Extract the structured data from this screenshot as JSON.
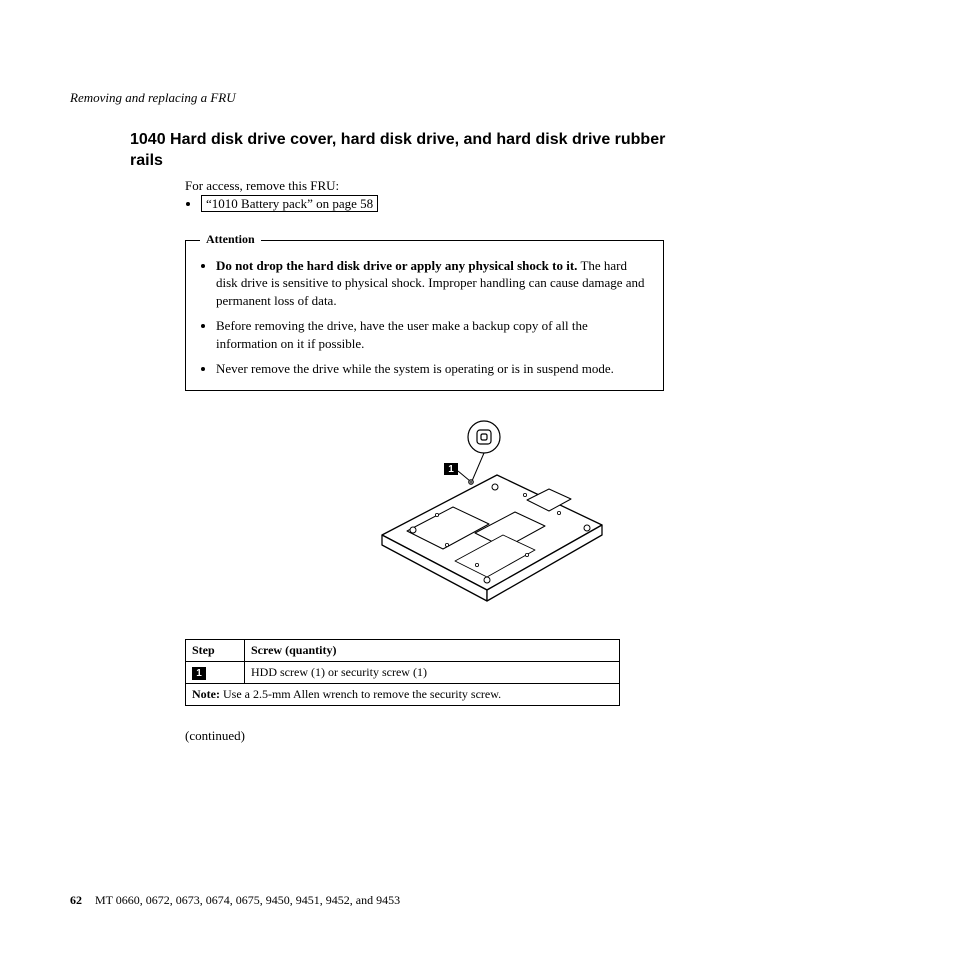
{
  "runningHead": "Removing and replacing a FRU",
  "section": {
    "title": "1040 Hard disk drive cover, hard disk drive, and hard disk drive rubber rails",
    "lead": "For access, remove this FRU:",
    "linkText": "“1010 Battery pack” on page 58"
  },
  "attention": {
    "legend": "Attention",
    "items": {
      "b1_bold": "Do not drop the hard disk drive or apply any physical shock to it.",
      "b1_rest": " The hard disk drive is sensitive to physical shock. Improper handling can cause damage and permanent loss of data.",
      "b2": "Before removing the drive, have the user make a backup copy of all the information on it if possible.",
      "b3": "Never remove the drive while the system is operating or is in suspend mode."
    }
  },
  "figure": {
    "callout": "1"
  },
  "table": {
    "h_step": "Step",
    "h_screw": "Screw (quantity)",
    "row1_step": "1",
    "row1_screw": "HDD screw (1) or security screw (1)",
    "note_label": "Note:",
    "note_text": " Use a 2.5-mm Allen wrench to remove the security screw."
  },
  "continued": "(continued)",
  "footer": {
    "pageNum": "62",
    "text": "MT 0660, 0672, 0673, 0674, 0675, 9450, 9451, 9452, and 9453"
  }
}
